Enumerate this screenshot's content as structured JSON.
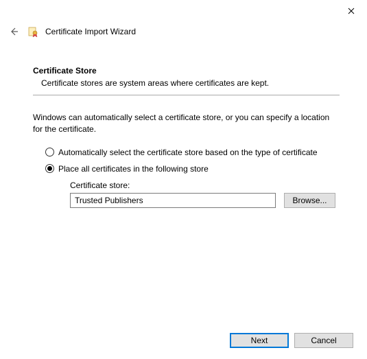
{
  "titlebar": {
    "close_glyph": "✕"
  },
  "header": {
    "title": "Certificate Import Wizard"
  },
  "section": {
    "title": "Certificate Store",
    "description": "Certificate stores are system areas where certificates are kept."
  },
  "instruction": "Windows can automatically select a certificate store, or you can specify a location for the certificate.",
  "radios": {
    "auto": "Automatically select the certificate store based on the type of certificate",
    "manual": "Place all certificates in the following store",
    "selected": "manual"
  },
  "store": {
    "label": "Certificate store:",
    "value": "Trusted Publishers",
    "browse_label": "Browse..."
  },
  "footer": {
    "next": "Next",
    "cancel": "Cancel"
  }
}
